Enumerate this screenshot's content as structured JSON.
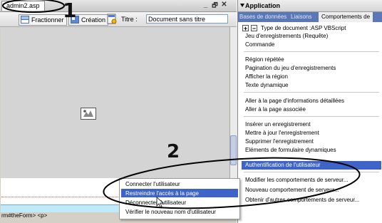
{
  "doc": {
    "tab_label": "admin2.asp",
    "win_controls": [
      "_",
      "🗗",
      "✕"
    ]
  },
  "toolbar": {
    "split_label": "Fractionner",
    "design_label": "Création",
    "title_label": "Titre :",
    "title_value": "Document sans titre"
  },
  "status": {
    "tag_path": "rm#theForm> <p>"
  },
  "annotations": {
    "n1": "1",
    "n2": "2"
  },
  "panel": {
    "title": "Application",
    "tabs": [
      "Bases de données",
      "Liaisons",
      "Comportements de"
    ],
    "doc_type": "Type de document :ASP VBScript",
    "plus": "+",
    "minus": "−",
    "items": [
      "Jeu d'enregistrements (Requête)",
      "Commande",
      "Région répétée",
      "Pagination du jeu d'enregistrements",
      "Afficher la région",
      "Texte dynamique",
      "Aller à la page d'informations détaillées",
      "Aller à la page associée",
      "Insérer un enregistrement",
      "Mettre à jour l'enregistrement",
      "Supprimer l'enregistrement",
      "Eléments de formulaire dynamiques",
      "Authentification de l'utilisateur",
      "Modifier les comportements de serveur...",
      "Nouveau comportement de serveur...",
      "Obtenir d'autres comportements de serveur..."
    ]
  },
  "submenu": {
    "items": [
      "Connecter l'utilisateur",
      "Restreindre l'accès à la page",
      "Déconnecter l'utilisateur",
      "Vérifier le nouveau nom d'utilisateur"
    ]
  },
  "colors": {
    "highlight": "#3f64c8",
    "annotation_ring": "#000000"
  }
}
